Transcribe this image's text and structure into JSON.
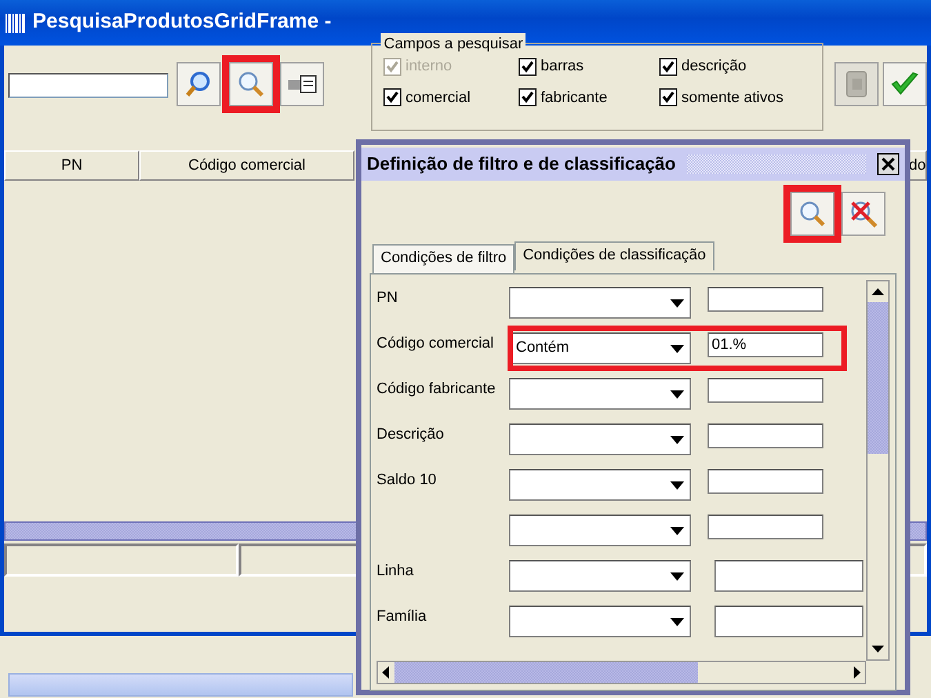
{
  "window": {
    "title": "PesquisaProdutosGridFrame -"
  },
  "toolbar_buttons": [
    {
      "kind": "search",
      "highlighted": false
    },
    {
      "kind": "filter",
      "highlighted": true
    },
    {
      "kind": "export",
      "highlighted": false
    }
  ],
  "search_group": {
    "title": "Campos a pesquisar",
    "options": [
      {
        "label": "interno",
        "checked": true,
        "disabled": true
      },
      {
        "label": "barras",
        "checked": true,
        "disabled": false
      },
      {
        "label": "descrição",
        "checked": true,
        "disabled": false
      },
      {
        "label": "comercial",
        "checked": true,
        "disabled": false
      },
      {
        "label": "fabricante",
        "checked": true,
        "disabled": false
      },
      {
        "label": "somente ativos",
        "checked": true,
        "disabled": false
      }
    ]
  },
  "right_buttons": [
    {
      "kind": "document",
      "disabled": true
    },
    {
      "kind": "confirm",
      "disabled": false
    }
  ],
  "grid": {
    "columns": [
      "PN",
      "Código comercial",
      "do"
    ]
  },
  "dialog": {
    "title": "Definição de filtro e de classificação",
    "buttons": [
      {
        "kind": "filter",
        "highlighted": true
      },
      {
        "kind": "clear",
        "highlighted": false
      }
    ],
    "tabs": [
      {
        "label": "Condições de filtro",
        "selected": true
      },
      {
        "label": "Condições de classificação",
        "selected": false
      }
    ],
    "rows": [
      {
        "label": "PN",
        "kind": "short",
        "highlighted": false
      },
      {
        "label": "Código comercial",
        "operator": "Contém",
        "value": "01.%",
        "kind": "short",
        "highlighted": true
      },
      {
        "label": "Código fabricante",
        "kind": "short",
        "highlighted": false
      },
      {
        "label": "Descrição",
        "kind": "short",
        "highlighted": false
      },
      {
        "label": "Saldo 10",
        "kind": "short",
        "highlighted": false
      },
      {
        "kind": "short",
        "highlighted": false
      },
      {
        "label": "Linha",
        "kind": "long",
        "highlighted": false
      },
      {
        "label": "Família",
        "kind": "long",
        "highlighted": false
      }
    ]
  }
}
